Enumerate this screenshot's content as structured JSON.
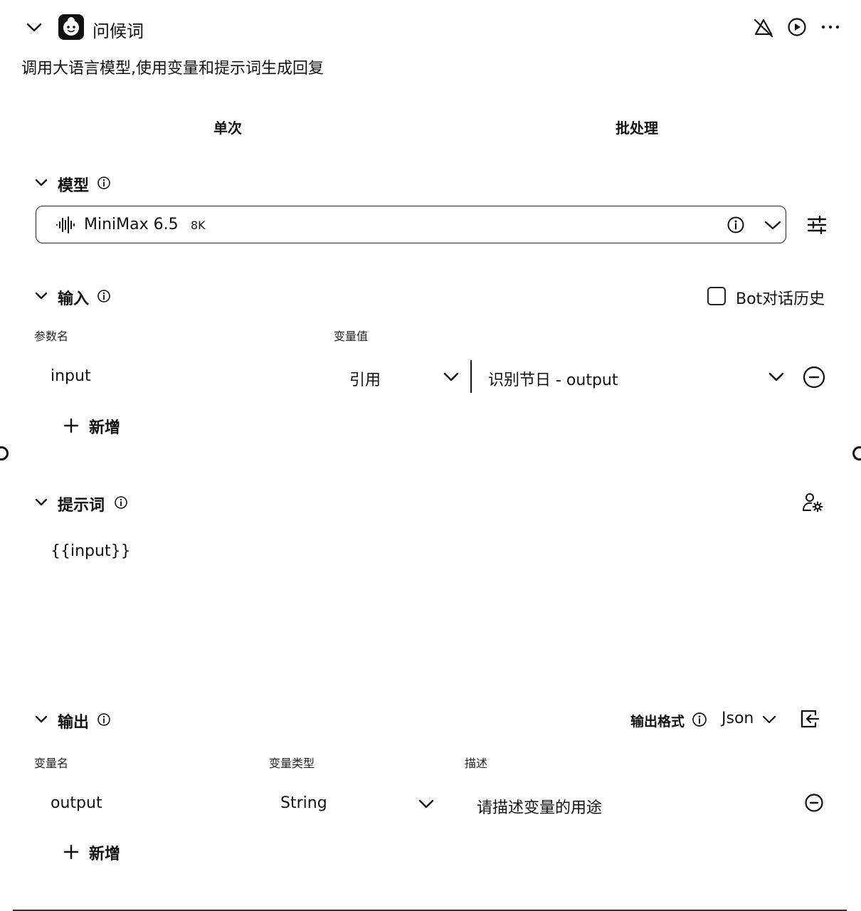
{
  "header": {
    "title": "问候词",
    "description": "调用大语言模型,使用变量和提示词生成回复"
  },
  "tabs": [
    {
      "label": "单次"
    },
    {
      "label": "批处理"
    }
  ],
  "model_section": {
    "title": "模型",
    "model_name": "MiniMax 6.5",
    "context_badge": "8K"
  },
  "input_section": {
    "title": "输入",
    "history_checkbox_label": "Bot对话历史",
    "col_param_name": "参数名",
    "col_variable_value": "变量值",
    "rows": [
      {
        "name": "input",
        "source_type": "引用",
        "value": "识别节日 - output"
      }
    ],
    "add_label": "新增"
  },
  "prompt_section": {
    "title": "提示词",
    "content": "{{input}}"
  },
  "output_section": {
    "title": "输出",
    "format_label": "输出格式",
    "format_value": "Json",
    "col_var_name": "变量名",
    "col_var_type": "变量类型",
    "col_description": "描述",
    "rows": [
      {
        "name": "output",
        "type": "String",
        "description_placeholder": "请描述变量的用途"
      }
    ],
    "add_label": "新增"
  },
  "icons": {
    "collapse": "chevron-down-icon",
    "node_avatar": "bot-face-icon",
    "debug_off": "debug-off-icon",
    "run": "play-circle-icon",
    "more": "more-horizontal-icon",
    "info": "info-icon",
    "waveform": "waveform-icon",
    "settings": "sliders-icon",
    "remove": "minus-circle-icon",
    "add": "plus-icon",
    "user_settings": "user-gear-icon",
    "output_panel": "panel-in-icon"
  }
}
